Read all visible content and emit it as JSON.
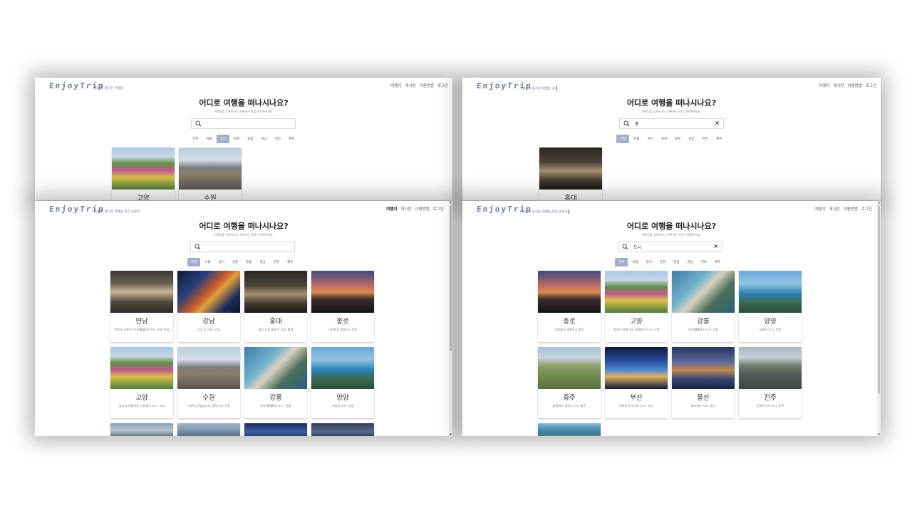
{
  "app": {
    "logo": "EnjoyTrip",
    "nav": [
      "여행지",
      "게시판",
      "이용방법",
      "로그인"
    ],
    "hero_title": "어디로 여행을 떠나시나요?",
    "hero_subtitle": "여행지를 검색하거나 목록에서 직접 선택해주세요.",
    "categories": [
      "전체",
      "서울",
      "경기",
      "강원",
      "충청",
      "경상",
      "전라",
      "제주"
    ]
  },
  "panels": {
    "top_left": {
      "tagline": "당신의 즐거운 여행을",
      "search_value": "",
      "selected_category": "경기",
      "cards": [
        {
          "name": "고양",
          "image": "flower-festival-photo"
        },
        {
          "name": "수원",
          "image": "fortress-city-photo"
        }
      ]
    },
    "top_right": {
      "tagline": "당신의 즐거운 여행을 위",
      "search_value": "홍",
      "selected_category": "전체",
      "cards": [
        {
          "name": "홍대",
          "image": "night-street-photo"
        }
      ]
    },
    "bottom_left": {
      "tagline": "당신의 즐거운 여행을 위한 솔루션",
      "search_value": "",
      "selected_category": "전체",
      "cards": [
        {
          "name": "연남",
          "desc": "보존과 조화의 미덕(美德)을 아는 동네, 연남",
          "image": "shop-street-photo"
        },
        {
          "name": "강남",
          "desc": "도심 속 여유, 강남",
          "image": "city-intersection-photo"
        },
        {
          "name": "홍대",
          "desc": "젊고 싶은 젊음의 거리, 홍대",
          "image": "night-street-photo"
        },
        {
          "name": "종로",
          "desc": "사람중심 명품도시 종로",
          "image": "palace-sunset-photo"
        },
        {
          "name": "고양",
          "desc": "꽃보다 아름다운 사람들의 도시, 고양",
          "image": "flower-festival-photo"
        },
        {
          "name": "수원",
          "desc": "사람이 반갑습니다, 휴먼시티 수원",
          "image": "fortress-city-photo"
        },
        {
          "name": "강릉",
          "desc": "호젓(豪靜)한 도시, 강릉",
          "image": "coast-aerial-photo"
        },
        {
          "name": "양양",
          "desc": "서핑의 도시, 양양",
          "image": "ocean-pavilion-photo"
        }
      ]
    },
    "bottom_right": {
      "tagline": "당신의 즐거운 여행을 위한 솔루션",
      "search_value": "도시",
      "selected_category": "전체",
      "cards": [
        {
          "name": "종로",
          "desc": "사람중심 명품도시 종로",
          "image": "palace-sunset-photo"
        },
        {
          "name": "고양",
          "desc": "꽃보다 아름다운 사람들의 도시, 고양",
          "image": "flower-festival-photo"
        },
        {
          "name": "강릉",
          "desc": "호젓(豪靜)한 도시, 강릉",
          "image": "coast-aerial-photo"
        },
        {
          "name": "양양",
          "desc": "서핑의 도시, 양양",
          "image": "ocean-pavilion-photo"
        },
        {
          "name": "충주",
          "desc": "충청북도 제2의 도시, 충주",
          "image": "pagoda-field-photo"
        },
        {
          "name": "부산",
          "desc": "대한민국 제 2의 도시, 부산",
          "image": "bridge-night-photo"
        },
        {
          "name": "울산",
          "desc": "해오름의 도시, 울산",
          "image": "industrial-night-photo"
        },
        {
          "name": "전주",
          "desc": "문화유산의 도시, 전주",
          "image": "hanok-village-photo"
        }
      ]
    }
  },
  "colors": {
    "brand": "#6b78a8",
    "selected_category": "#a3abcf",
    "clear_icon": "#1b2c6b"
  }
}
